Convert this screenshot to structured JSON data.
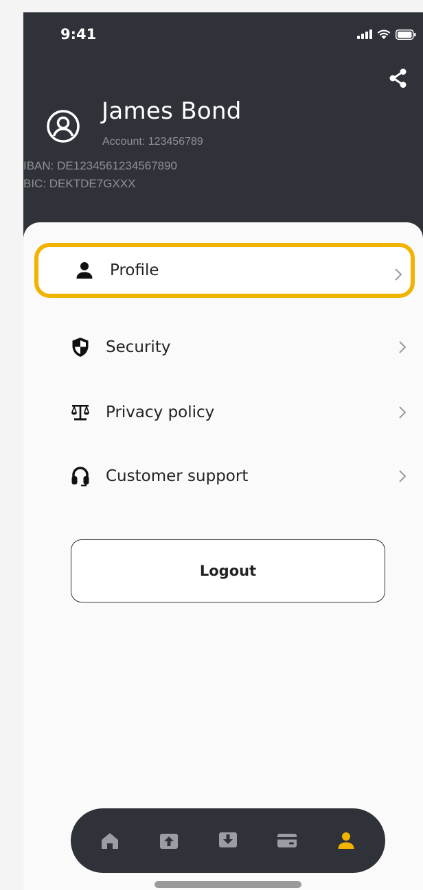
{
  "status_bar": {
    "time": "9:41",
    "icons": [
      "signal-icon",
      "wifi-icon",
      "battery-icon"
    ]
  },
  "header": {
    "share_icon": "share-icon",
    "avatar_icon": "user-circle-icon",
    "name": "James Bond",
    "account": "Account: 123456789",
    "iban": "IBAN: DE1234561234567890",
    "bic": "BIC: DEKTDE7GXXX"
  },
  "menu": {
    "items": [
      {
        "label": "Profile",
        "icon": "person-icon",
        "highlighted": true
      },
      {
        "label": "Security",
        "icon": "shield-icon",
        "highlighted": false
      },
      {
        "label": "Privacy policy",
        "icon": "scales-icon",
        "highlighted": false
      },
      {
        "label": "Customer support",
        "icon": "headset-icon",
        "highlighted": false
      }
    ]
  },
  "logout_label": "Logout",
  "tab_bar": {
    "tabs": [
      {
        "icon": "home-icon",
        "active": false
      },
      {
        "icon": "upload-icon",
        "active": false
      },
      {
        "icon": "download-icon",
        "active": false
      },
      {
        "icon": "card-icon",
        "active": false
      },
      {
        "icon": "profile-icon",
        "active": true
      }
    ]
  },
  "colors": {
    "header_bg": "#2f3238",
    "highlight": "#f0b400",
    "active_tab": "#f0b400",
    "inactive_tab": "#9a9da3"
  }
}
